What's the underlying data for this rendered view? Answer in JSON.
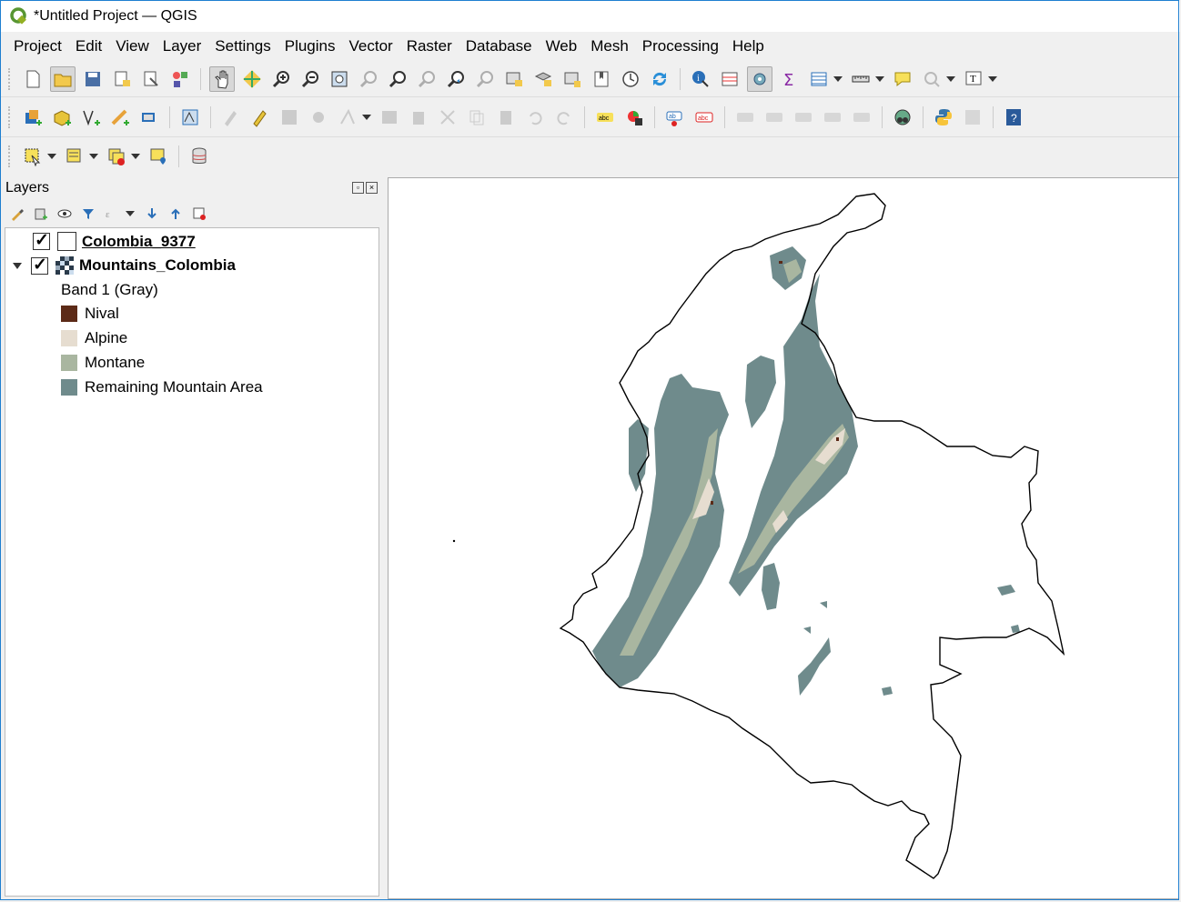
{
  "window": {
    "title": "*Untitled Project — QGIS",
    "app_icon": "qgis-logo-icon"
  },
  "menu": [
    "Project",
    "Edit",
    "View",
    "Layer",
    "Settings",
    "Plugins",
    "Vector",
    "Raster",
    "Database",
    "Web",
    "Mesh",
    "Processing",
    "Help"
  ],
  "toolbar_rows": {
    "row1": [
      "new-project-icon",
      "open-project-icon",
      "save-project-icon",
      "new-print-layout-icon",
      "layout-manager-icon",
      "style-manager-icon",
      "pan-icon",
      "pan-to-selection-icon",
      "zoom-in-icon",
      "zoom-out-icon",
      "zoom-full-icon",
      "zoom-to-selection-icon",
      "zoom-to-layer-icon",
      "zoom-native-icon",
      "zoom-last-icon",
      "zoom-next-icon",
      "new-map-view-icon",
      "new-3d-view-icon",
      "new-bookmark-icon",
      "show-bookmarks-icon",
      "temporal-controller-icon",
      "refresh-icon",
      "identify-icon",
      "attribute-table-icon",
      "statistics-icon",
      "sum-icon",
      "open-table-icon",
      "measure-icon",
      "map-tips-icon",
      "locate-icon",
      "text-annotation-icon"
    ],
    "row2": [
      "data-source-manager-icon",
      "new-geopackage-icon",
      "digitize-vertex-icon",
      "digitize-line-icon",
      "new-virtual-layer-icon",
      "vertex-tool-icon",
      "current-edits-icon",
      "toggle-editing-icon",
      "save-edits-icon",
      "add-feature-icon",
      "vertex-editor-icon",
      "modify-attributes-icon",
      "delete-selected-icon",
      "cut-features-icon",
      "copy-features-icon",
      "paste-features-icon",
      "undo-icon",
      "redo-icon",
      "label-icon",
      "diagram-icon",
      "pin-label-icon",
      "show-hide-labels-icon",
      "move-label-icon",
      "rotate-label-icon",
      "change-label-icon",
      "label-tool-a-icon",
      "label-tool-b-icon",
      "osm-icon",
      "python-console-icon",
      "plugin-icon",
      "help-icon"
    ],
    "row3": [
      "select-features-icon",
      "select-by-value-icon",
      "deselect-icon",
      "select-location-icon",
      "db-manager-icon"
    ]
  },
  "layers_panel": {
    "title": "Layers",
    "layers": [
      {
        "name": "Colombia_9377",
        "checked": true,
        "symbol": "polygon-outline"
      },
      {
        "name": "Mountains_Colombia",
        "checked": true,
        "symbol": "raster",
        "band": "Band 1 (Gray)",
        "legend": [
          {
            "label": "Nival",
            "color": "#5c2a17"
          },
          {
            "label": "Alpine",
            "color": "#e6ddd0"
          },
          {
            "label": "Montane",
            "color": "#a9b6a0"
          },
          {
            "label": "Remaining Mountain Area",
            "color": "#6f8b8c"
          }
        ]
      }
    ]
  },
  "map": {
    "outline_color": "#000000",
    "remaining_color": "#6f8b8c",
    "montane_color": "#a9b6a0",
    "alpine_color": "#e6ddd0",
    "nival_color": "#5c2a17"
  }
}
